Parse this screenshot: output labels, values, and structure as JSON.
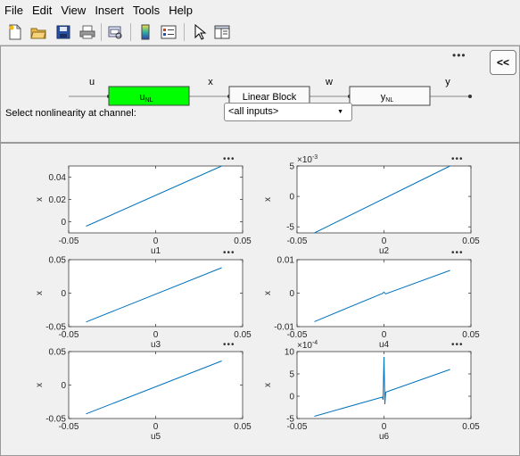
{
  "menu": [
    "File",
    "Edit",
    "View",
    "Insert",
    "Tools",
    "Help"
  ],
  "toolbar_icons": [
    "new-file-icon",
    "open-folder-icon",
    "save-icon",
    "print-icon",
    "print-preview-icon",
    "colorbar-icon",
    "legend-icon",
    "pointer-icon",
    "panels-icon"
  ],
  "diagram": {
    "labels": [
      "u",
      "x",
      "w",
      "y"
    ],
    "block_input": "u",
    "block_input_sub": "NL",
    "block_linear": "Linear Block",
    "block_output": "y",
    "block_output_sub": "NL",
    "select_label": "Select nonlinearity at channel:",
    "select_value": "<all inputs>",
    "collapse_button": "<<",
    "colors": {
      "input_block": "#00ff00",
      "line": "#0072bd"
    }
  },
  "chart_data": [
    {
      "type": "line",
      "xlabel": "u1",
      "ylabel": "x",
      "xlim": [
        -0.05,
        0.05
      ],
      "ylim": [
        -0.01,
        0.05
      ],
      "xticks": [
        "-0.05",
        "0",
        "0.05"
      ],
      "yticks": [
        "0.04",
        "0.02",
        "0"
      ],
      "ytick_values": [
        0.04,
        0.02,
        0
      ],
      "x": [
        -0.04,
        0.038
      ],
      "y": [
        -0.004,
        0.05
      ]
    },
    {
      "type": "line",
      "xlabel": "u2",
      "ylabel": "x",
      "exponent": "×10",
      "exponent_power": "-3",
      "xlim": [
        -0.05,
        0.05
      ],
      "ylim": [
        -6,
        5
      ],
      "xticks": [
        "-0.05",
        "0",
        "0.05"
      ],
      "yticks": [
        "5",
        "0",
        "-5"
      ],
      "ytick_values": [
        5,
        0,
        -5
      ],
      "x": [
        -0.04,
        0.038
      ],
      "y": [
        -6,
        5
      ]
    },
    {
      "type": "line",
      "xlabel": "u3",
      "ylabel": "x",
      "xlim": [
        -0.05,
        0.05
      ],
      "ylim": [
        -0.05,
        0.05
      ],
      "xticks": [
        "-0.05",
        "0",
        "0.05"
      ],
      "yticks": [
        "0.05",
        "0",
        "-0.05"
      ],
      "ytick_values": [
        0.05,
        0,
        -0.05
      ],
      "x": [
        -0.04,
        0.038
      ],
      "y": [
        -0.043,
        0.038
      ]
    },
    {
      "type": "line",
      "xlabel": "u4",
      "ylabel": "x",
      "xlim": [
        -0.05,
        0.05
      ],
      "ylim": [
        -0.01,
        0.01
      ],
      "xticks": [
        "-0.05",
        "0",
        "0.05"
      ],
      "yticks": [
        "0.01",
        "0",
        "-0.01"
      ],
      "ytick_values": [
        0.01,
        0,
        -0.01
      ],
      "x": [
        -0.04,
        -0.001,
        0,
        0.001,
        0.038
      ],
      "y": [
        -0.0085,
        -0.0001,
        0.0003,
        -0.0002,
        0.0068
      ]
    },
    {
      "type": "line",
      "xlabel": "u5",
      "ylabel": "x",
      "xlim": [
        -0.05,
        0.05
      ],
      "ylim": [
        -0.05,
        0.05
      ],
      "xticks": [
        "-0.05",
        "0",
        "0.05"
      ],
      "yticks": [
        "0.05",
        "0",
        "-0.05"
      ],
      "ytick_values": [
        0.05,
        0,
        -0.05
      ],
      "x": [
        -0.04,
        0.038
      ],
      "y": [
        -0.043,
        0.036
      ]
    },
    {
      "type": "line",
      "xlabel": "u6",
      "ylabel": "x",
      "exponent": "×10",
      "exponent_power": "-4",
      "xlim": [
        -0.05,
        0.05
      ],
      "ylim": [
        -5,
        10
      ],
      "xticks": [
        "-0.05",
        "0",
        "0.05"
      ],
      "yticks": [
        "10",
        "5",
        "0",
        "-5"
      ],
      "ytick_values": [
        10,
        5,
        0,
        -5
      ],
      "x": [
        -0.04,
        -0.001,
        -0.0005,
        0,
        0.0005,
        0.001,
        0.038
      ],
      "y": [
        -4.5,
        -0.2,
        -0.8,
        8.8,
        -1.8,
        0.9,
        6
      ]
    }
  ]
}
